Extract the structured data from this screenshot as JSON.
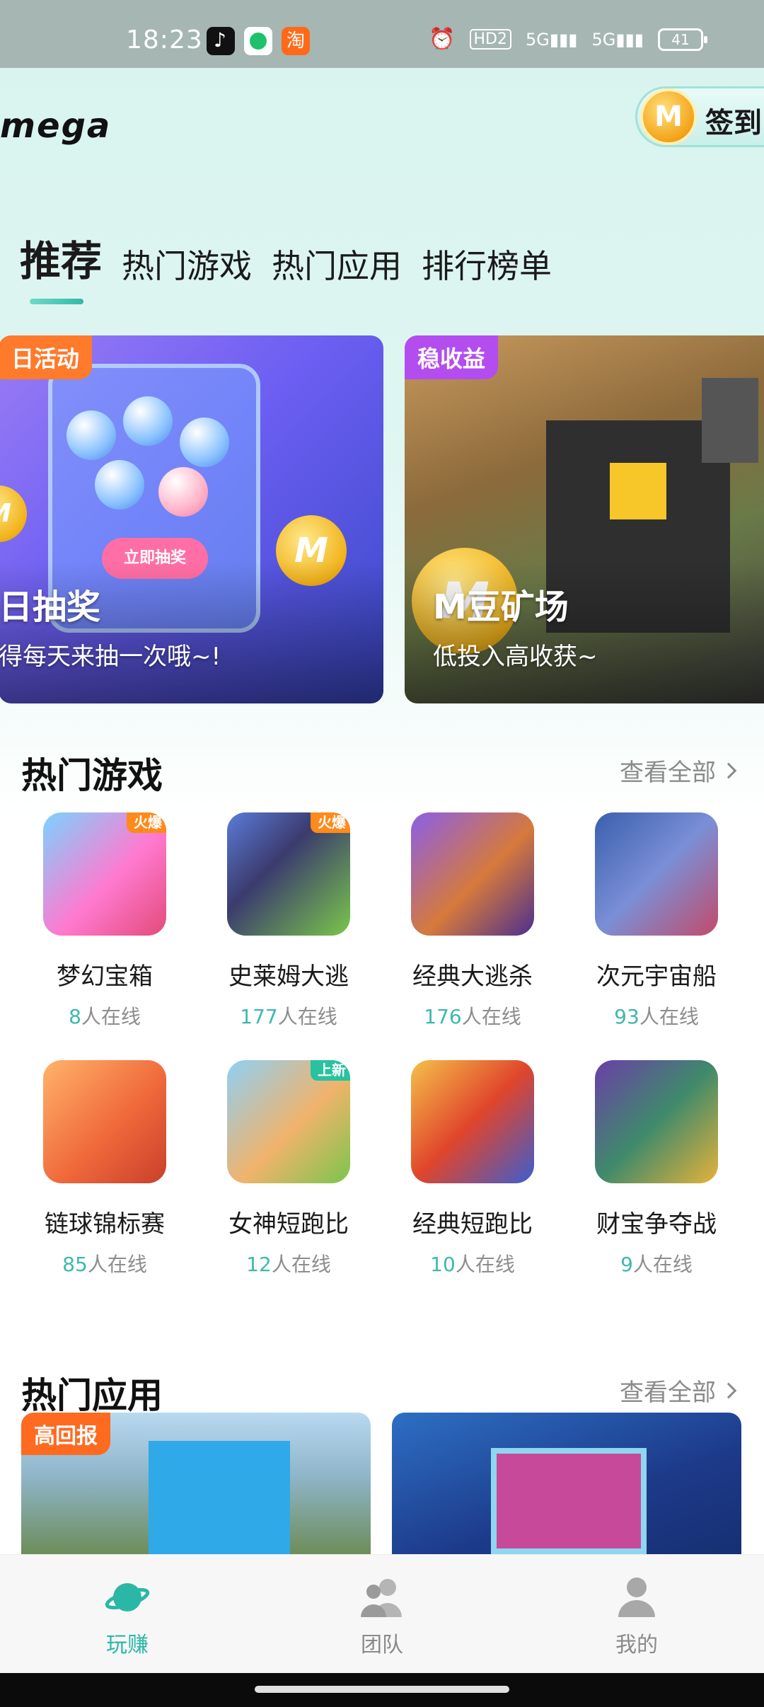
{
  "status_bar": {
    "time": "18:23",
    "hd": "HD2",
    "net1": "5G",
    "net2": "5G",
    "battery": "41"
  },
  "header": {
    "logo": "mega",
    "signin_label": "签到",
    "coin_letter": "M"
  },
  "tabs": [
    {
      "label": "推荐",
      "active": true
    },
    {
      "label": "热门游戏",
      "active": false
    },
    {
      "label": "热门应用",
      "active": false
    },
    {
      "label": "排行榜单",
      "active": false
    }
  ],
  "banners": [
    {
      "tag": "日活动",
      "title": "日抽奖",
      "subtitle": "得每天来抽一次哦~!",
      "button_text": "立即抽奖"
    },
    {
      "tag": "稳收益",
      "title": "M豆矿场",
      "subtitle": "低投入高收获~"
    }
  ],
  "hot_games": {
    "title": "热门游戏",
    "view_all": "查看全部",
    "online_suffix": "人在线",
    "items": [
      {
        "name": "梦幻宝箱",
        "online": "8",
        "badge": "火爆"
      },
      {
        "name": "史莱姆大逃",
        "online": "177",
        "badge": "火爆"
      },
      {
        "name": "经典大逃杀",
        "online": "176",
        "badge": ""
      },
      {
        "name": "次元宇宙船",
        "online": "93",
        "badge": ""
      },
      {
        "name": "链球锦标赛",
        "online": "85",
        "badge": ""
      },
      {
        "name": "女神短跑比",
        "online": "12",
        "badge": "上新"
      },
      {
        "name": "经典短跑比",
        "online": "10",
        "badge": ""
      },
      {
        "name": "财宝争夺战",
        "online": "9",
        "badge": ""
      }
    ]
  },
  "hot_apps": {
    "title": "热门应用",
    "view_all": "查看全部",
    "items": [
      {
        "tag": "高回报"
      },
      {
        "tag": ""
      }
    ]
  },
  "bottom_nav": [
    {
      "label": "玩赚",
      "icon": "planet-icon",
      "active": true
    },
    {
      "label": "团队",
      "icon": "team-icon",
      "active": false
    },
    {
      "label": "我的",
      "icon": "user-icon",
      "active": false
    }
  ],
  "colors": {
    "accent": "#2bb7a6",
    "orange_tag": "#ff7a2b",
    "purple_tag": "#b34df0",
    "status_bar": "#a5b6b3"
  }
}
